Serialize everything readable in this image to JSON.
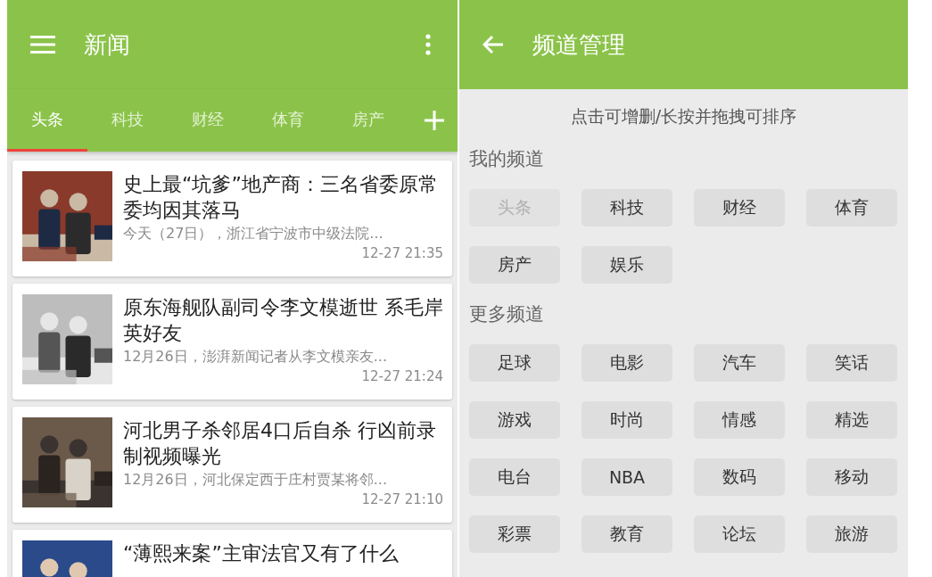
{
  "news_screen": {
    "title": "新闻",
    "tabs": [
      {
        "label": "头条",
        "selected": true
      },
      {
        "label": "科技",
        "selected": false
      },
      {
        "label": "财经",
        "selected": false
      },
      {
        "label": "体育",
        "selected": false
      },
      {
        "label": "房产",
        "selected": false
      }
    ],
    "articles": [
      {
        "title": "史上最“坑爹”地产商：三名省委原常委均因其落马",
        "summary": "今天（27日），浙江省宁波市中级法院...",
        "time": "12-27 21:35"
      },
      {
        "title": "原东海舰队副司令李文模逝世 系毛岸英好友",
        "summary": "12月26日，澎湃新闻记者从李文模亲友...",
        "time": "12-27 21:24"
      },
      {
        "title": "河北男子杀邻居4口后自杀 行凶前录制视频曝光",
        "summary": "12月26日，河北保定西于庄村贾某将邻...",
        "time": "12-27 21:10"
      },
      {
        "title": "“薄熙来案”主审法官又有了什么"
      }
    ]
  },
  "channel_screen": {
    "title": "频道管理",
    "hint": "点击可增删/长按并拖拽可排序",
    "sections": [
      {
        "heading": "我的频道",
        "channels": [
          {
            "label": "头条",
            "disabled": true
          },
          {
            "label": "科技",
            "disabled": false
          },
          {
            "label": "财经",
            "disabled": false
          },
          {
            "label": "体育",
            "disabled": false
          },
          {
            "label": "房产",
            "disabled": false
          },
          {
            "label": "娱乐",
            "disabled": false
          }
        ]
      },
      {
        "heading": "更多频道",
        "channels": [
          {
            "label": "足球",
            "disabled": false
          },
          {
            "label": "电影",
            "disabled": false
          },
          {
            "label": "汽车",
            "disabled": false
          },
          {
            "label": "笑话",
            "disabled": false
          },
          {
            "label": "游戏",
            "disabled": false
          },
          {
            "label": "时尚",
            "disabled": false
          },
          {
            "label": "情感",
            "disabled": false
          },
          {
            "label": "精选",
            "disabled": false
          },
          {
            "label": "电台",
            "disabled": false
          },
          {
            "label": "NBA",
            "disabled": false
          },
          {
            "label": "数码",
            "disabled": false
          },
          {
            "label": "移动",
            "disabled": false
          },
          {
            "label": "彩票",
            "disabled": false
          },
          {
            "label": "教育",
            "disabled": false
          },
          {
            "label": "论坛",
            "disabled": false
          },
          {
            "label": "旅游",
            "disabled": false
          }
        ]
      }
    ]
  }
}
